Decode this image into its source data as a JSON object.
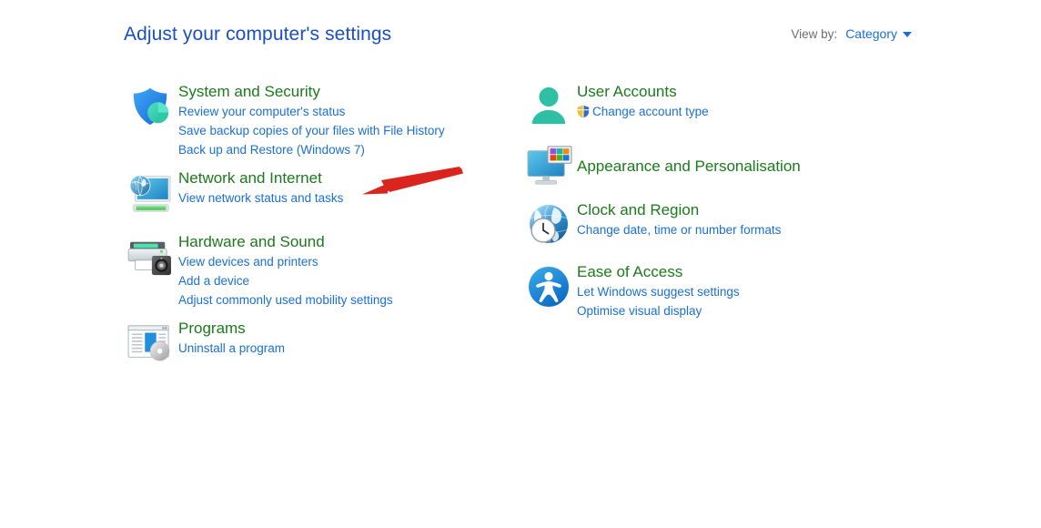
{
  "header": {
    "title": "Adjust your computer's settings",
    "view_by_label": "View by:",
    "view_by_value": "Category",
    "caret_icon": "chevron-down-icon"
  },
  "colors": {
    "title_blue": "#1a4fc4",
    "category_green": "#1b7a1b",
    "link_blue": "#1a6fd4",
    "label_gray": "#6d6d6d",
    "annotation_red": "#d9251d",
    "background": "#ffffff"
  },
  "annotation": {
    "type": "arrow",
    "color": "#d9251d",
    "points_to": "Network and Internet",
    "direction": "right-to-left"
  },
  "left_column": [
    {
      "id": "system-and-security",
      "icon": "shield-icon",
      "title": "System and Security",
      "links": [
        "Review your computer's status",
        "Save backup copies of your files with File History",
        "Back up and Restore (Windows 7)"
      ]
    },
    {
      "id": "network-and-internet",
      "icon": "network-monitor-icon",
      "title": "Network and Internet",
      "links": [
        "View network status and tasks"
      ]
    },
    {
      "id": "hardware-and-sound",
      "icon": "printer-speaker-icon",
      "title": "Hardware and Sound",
      "links": [
        "View devices and printers",
        "Add a device",
        "Adjust commonly used mobility settings"
      ]
    },
    {
      "id": "programs",
      "icon": "programs-disc-icon",
      "title": "Programs",
      "links": [
        "Uninstall a program"
      ]
    }
  ],
  "right_column": [
    {
      "id": "user-accounts",
      "icon": "user-person-icon",
      "title": "User Accounts",
      "links": [
        {
          "label": "Change account type",
          "icon": "uac-shield-icon"
        }
      ]
    },
    {
      "id": "appearance-and-personalisation",
      "icon": "appearance-monitor-icon",
      "title": "Appearance and Personalisation",
      "links": []
    },
    {
      "id": "clock-and-region",
      "icon": "clock-globe-icon",
      "title": "Clock and Region",
      "links": [
        {
          "label": "Change date, time or number formats"
        }
      ]
    },
    {
      "id": "ease-of-access",
      "icon": "accessibility-icon",
      "title": "Ease of Access",
      "links": [
        {
          "label": "Let Windows suggest settings"
        },
        {
          "label": "Optimise visual display"
        }
      ]
    }
  ]
}
